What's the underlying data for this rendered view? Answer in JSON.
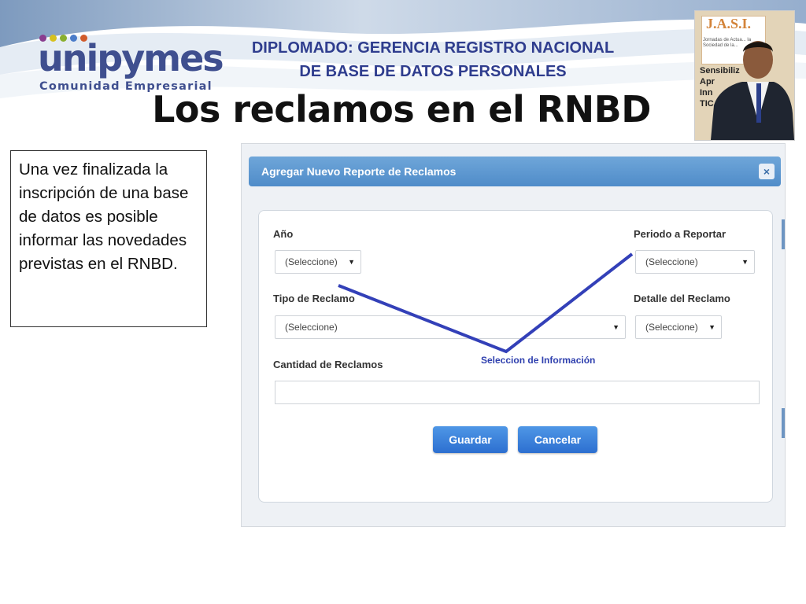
{
  "logo": {
    "wordmark": "unipymes",
    "tagline": "Comunidad Empresarial",
    "dot_colors": [
      "#8a3d8f",
      "#d7c11e",
      "#8aaf2e",
      "#4a7cc9",
      "#d15b2b"
    ]
  },
  "header": {
    "line1": "DIPLOMADO: GERENCIA REGISTRO NACIONAL",
    "line2": "DE BASE DE DATOS PERSONALES"
  },
  "slide_title": "Los reclamos en el RNBD",
  "photo": {
    "banner": "J.A.S.I.",
    "banner_sub": "Jornadas de Actua... la Sociedad de la...",
    "words": [
      "Sensibiliz",
      "Apr",
      "Inn",
      "TIC"
    ]
  },
  "callout": {
    "text": "Una vez finalizada la inscripción de una base de datos es posible informar las novedades previstas en el RNBD."
  },
  "modal": {
    "title": "Agregar Nuevo Reporte de Reclamos",
    "close_glyph": "×",
    "fields": {
      "anio_label": "Año",
      "anio_value": "(Seleccione)",
      "periodo_label": "Periodo a Reportar",
      "periodo_value": "(Seleccione)",
      "tipo_label": "Tipo de Reclamo",
      "tipo_value": "(Seleccione)",
      "detalle_label": "Detalle del Reclamo",
      "detalle_value": "(Seleccione)",
      "cantidad_label": "Cantidad de Reclamos",
      "cantidad_value": ""
    },
    "buttons": {
      "save": "Guardar",
      "cancel": "Cancelar"
    },
    "dropdown_arrow": "▼"
  },
  "annotation": {
    "text": "Seleccion de Información",
    "color": "#3340b8"
  }
}
